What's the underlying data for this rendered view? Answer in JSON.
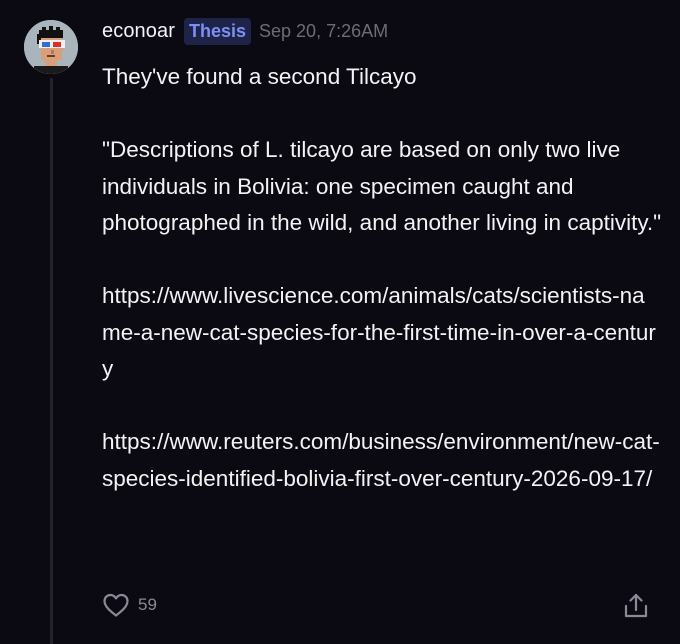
{
  "post": {
    "username": "econoar",
    "badge": "Thesis",
    "timestamp": "Sep 20, 7:26AM",
    "paragraphs": [
      "They've found a second Tilcayo",
      "\"Descriptions of L. tilcayo are based on only two live individuals in Bolivia: one specimen caught and photographed in the wild, and another living in captivity.\"",
      "https://www.livescience.com/animals/cats/scientists-name-a-new-cat-species-for-the-first-time-in-over-a-century",
      "https://www.reuters.com/business/environment/new-cat-species-identified-bolivia-first-over-century-2026-09-17/"
    ],
    "like_count": "59"
  },
  "icons": {
    "like": "heart-icon",
    "share": "share-upload-icon"
  },
  "colors": {
    "background": "#0b0a12",
    "badge_bg": "#1d2447",
    "badge_text": "#7f8ff5",
    "muted": "#6c6b78"
  }
}
